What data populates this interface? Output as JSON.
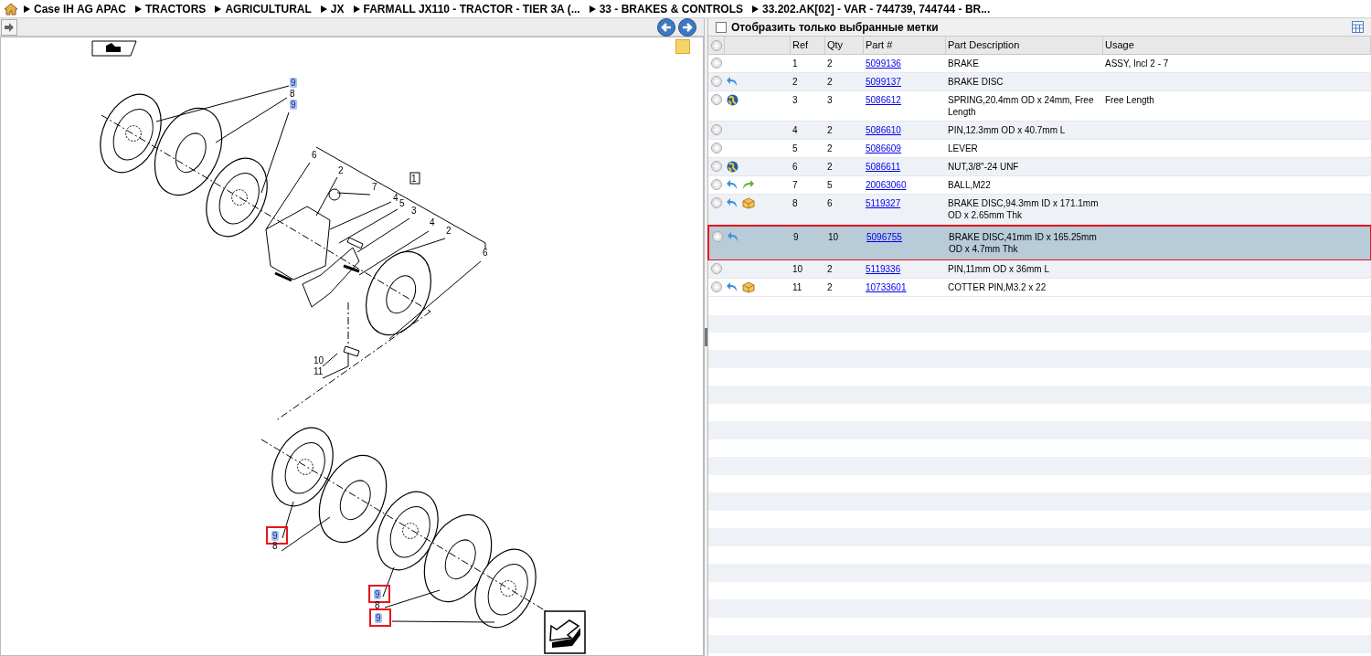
{
  "breadcrumb": [
    "Case IH AG APAC",
    "TRACTORS",
    "AGRICULTURAL",
    "JX",
    "FARMALL JX110 - TRACTOR - TIER 3A (...",
    "33 - BRAKES & CONTROLS",
    "33.202.AK[02] - VAR - 744739, 744744 - BR..."
  ],
  "filter": {
    "label": "Отобразить только выбранные метки",
    "checked": false
  },
  "table": {
    "columns": [
      "Ref",
      "Qty",
      "Part #",
      "Part Description",
      "Usage"
    ],
    "rows": [
      {
        "ref": "1",
        "qty": "2",
        "part": "5099136",
        "description": "BRAKE",
        "usage": "ASSY, Incl 2 - 7",
        "icons": [],
        "selected": false
      },
      {
        "ref": "2",
        "qty": "2",
        "part": "5099137",
        "description": "BRAKE DISC",
        "icons": [
          {
            "kind": "back"
          }
        ],
        "selected": false
      },
      {
        "ref": "3",
        "qty": "3",
        "part": "5086612",
        "description": "SPRING,20.4mm OD x 24mm, Free Length",
        "usage": "Free Length",
        "icons": [
          {
            "kind": "globe"
          }
        ],
        "selected": false
      },
      {
        "ref": "4",
        "qty": "2",
        "part": "5086610",
        "description": "PIN,12.3mm OD x 40.7mm L",
        "icons": [],
        "selected": false
      },
      {
        "ref": "5",
        "qty": "2",
        "part": "5086609",
        "description": "LEVER",
        "icons": [],
        "selected": false
      },
      {
        "ref": "6",
        "qty": "2",
        "part": "5086611",
        "description": "NUT,3/8\"-24 UNF",
        "icons": [
          {
            "kind": "globe"
          }
        ],
        "selected": false
      },
      {
        "ref": "7",
        "qty": "5",
        "part": "20063060",
        "description": "BALL,M22",
        "icons": [
          {
            "kind": "back"
          },
          {
            "kind": "forward"
          }
        ],
        "selected": false
      },
      {
        "ref": "8",
        "qty": "6",
        "part": "5119327",
        "description": "BRAKE DISC,94.3mm ID x 171.1mm OD x 2.65mm Thk",
        "icons": [
          {
            "kind": "back"
          },
          {
            "kind": "box"
          }
        ],
        "selected": false
      },
      {
        "ref": "9",
        "qty": "10",
        "part": "5096755",
        "description": "BRAKE DISC,41mm ID x 165.25mm OD x 4.7mm Thk",
        "icons": [
          {
            "kind": "back"
          }
        ],
        "selected": true
      },
      {
        "ref": "10",
        "qty": "2",
        "part": "5119336",
        "description": "PIN,11mm OD x 36mm L",
        "icons": [],
        "selected": false
      },
      {
        "ref": "11",
        "qty": "2",
        "part": "10733601",
        "description": "COTTER PIN,M3.2 x 22",
        "icons": [
          {
            "kind": "back"
          },
          {
            "kind": "box"
          }
        ],
        "selected": false
      }
    ]
  },
  "callouts": [
    {
      "label": "9",
      "highlighted": true,
      "framed": false
    },
    {
      "label": "8",
      "highlighted": false,
      "framed": false
    },
    {
      "label": "9",
      "highlighted": true,
      "framed": false
    },
    {
      "label": "6",
      "highlighted": false,
      "framed": false
    },
    {
      "label": "2",
      "highlighted": false,
      "framed": false
    },
    {
      "label": "7",
      "highlighted": false,
      "framed": false
    },
    {
      "label": "4",
      "highlighted": false,
      "framed": false
    },
    {
      "label": "5",
      "highlighted": false,
      "framed": false
    },
    {
      "label": "3",
      "highlighted": false,
      "framed": false
    },
    {
      "label": "1",
      "highlighted": false,
      "framed": false
    },
    {
      "label": "4",
      "highlighted": false,
      "framed": false
    },
    {
      "label": "2",
      "highlighted": false,
      "framed": false
    },
    {
      "label": "6",
      "highlighted": false,
      "framed": false
    },
    {
      "label": "10",
      "highlighted": false,
      "framed": false
    },
    {
      "label": "11",
      "highlighted": false,
      "framed": false
    },
    {
      "label": "9",
      "highlighted": true,
      "framed": true
    },
    {
      "label": "8",
      "highlighted": false,
      "framed": false
    },
    {
      "label": "9",
      "highlighted": true,
      "framed": true
    },
    {
      "label": "8",
      "highlighted": false,
      "framed": false
    },
    {
      "label": "9",
      "highlighted": true,
      "framed": true
    }
  ]
}
